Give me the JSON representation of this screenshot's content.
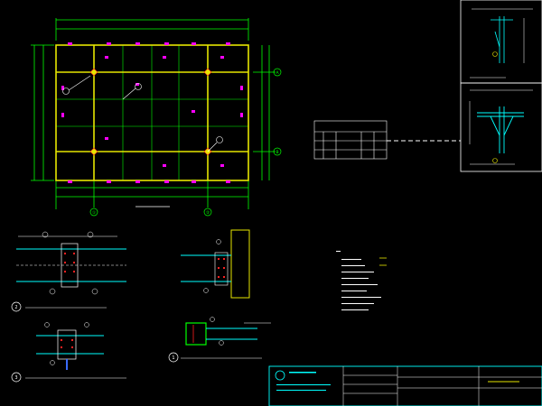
{
  "ui": {
    "background": "#000000",
    "colors": {
      "frame": "#ffffff",
      "beam_yellow": "#e6e600",
      "column_magenta": "#ff00ff",
      "grid_green": "#00ff00",
      "cyan": "#00ffff",
      "red": "#ff2020",
      "blue": "#3a6bff",
      "white": "#ffffff"
    }
  },
  "plan": {
    "title": "",
    "grid_axis_bottom": [
      "①",
      "②"
    ],
    "grid_axis_right": [
      "A",
      "B"
    ]
  },
  "details": {
    "detail_2_marker": "2",
    "detail_3_marker": "3",
    "detail_1_marker": "1"
  },
  "table": {
    "title": "",
    "headers": [
      "",
      "",
      "",
      ""
    ]
  },
  "title_block": {
    "company": "",
    "sheet_label": ""
  }
}
